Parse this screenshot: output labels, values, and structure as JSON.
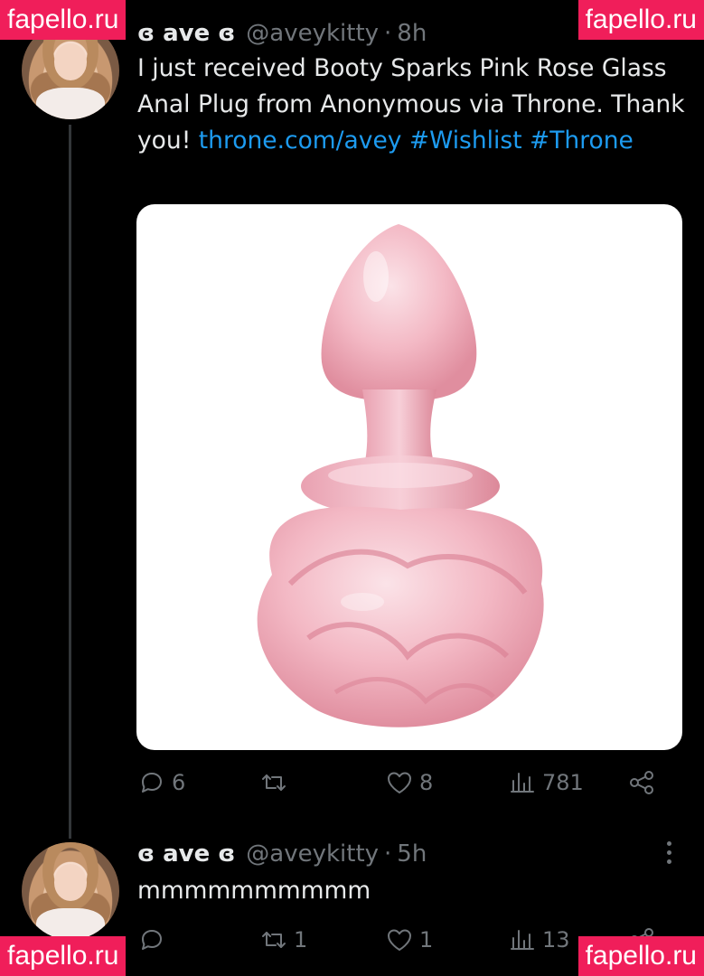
{
  "tweet1": {
    "name": "ɞ ave ɞ",
    "handle": "@aveykitty",
    "separator": "·",
    "time": "8h",
    "text_plain": "I just received Booty Sparks Pink Rose Glass Anal Plug from Anonymous via Throne. Thank you!",
    "link": "throne.com/avey",
    "hashtag1": "#Wishlist",
    "hashtag2": "#Throne",
    "replies": "6",
    "retweets": "",
    "likes": "8",
    "views": "781"
  },
  "tweet2": {
    "name": "ɞ ave ɞ",
    "handle": "@aveykitty",
    "separator": "·",
    "time": "5h",
    "text": "mmmmmmmmmm",
    "replies": "",
    "retweets": "1",
    "likes": "1",
    "views": "13"
  },
  "watermarks": {
    "top_left": "fapello.ru",
    "top_right": "fapello.ru",
    "bottom_left": "fapello.ru",
    "bottom_right": "fapello.ru"
  },
  "icons": [
    "reply-icon",
    "retweet-icon",
    "like-icon",
    "views-icon",
    "share-icon",
    "more-icon"
  ],
  "colors": {
    "background": "#000000",
    "text": "#e7e9ea",
    "muted": "#71767b",
    "link": "#1d9bf0",
    "watermark": "#f01e5a",
    "product_pink": "#f3b8c4"
  }
}
